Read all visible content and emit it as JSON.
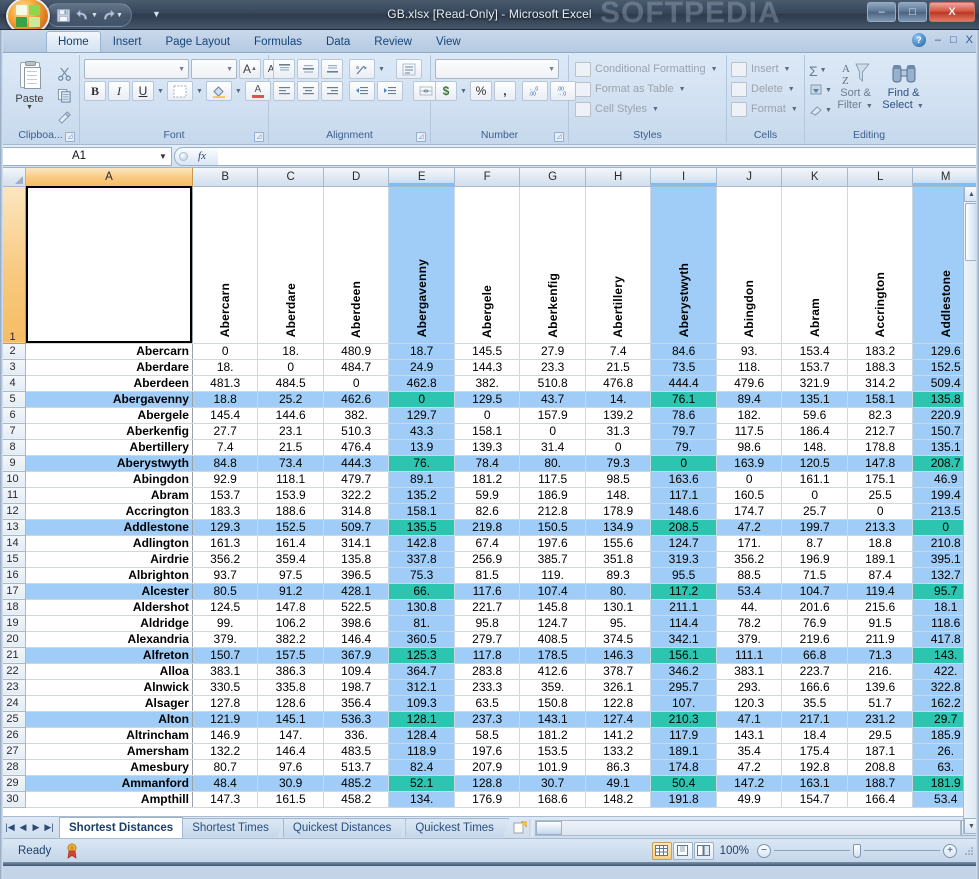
{
  "window": {
    "title": "GB.xlsx  [Read-Only] - Microsoft Excel",
    "watermark": "SOFTPEDIA",
    "minimize": "–",
    "maximize": "□",
    "close": "X"
  },
  "quick_access": {
    "save": "save-icon",
    "undo": "undo-icon",
    "redo": "redo-icon",
    "customize": "customize-icon"
  },
  "ribbon": {
    "tabs": [
      {
        "label": "Home",
        "active": true
      },
      {
        "label": "Insert",
        "active": false
      },
      {
        "label": "Page Layout",
        "active": false
      },
      {
        "label": "Formulas",
        "active": false
      },
      {
        "label": "Data",
        "active": false
      },
      {
        "label": "Review",
        "active": false
      },
      {
        "label": "View",
        "active": false
      }
    ],
    "help_label": "?",
    "minimize_ribbon": "–",
    "restore_window": "□",
    "close_window": "X",
    "groups": {
      "clipboard": {
        "label": "Clipboa...",
        "paste": "Paste",
        "cut": "cut-icon",
        "copy": "copy-icon",
        "format_painter": "format-painter-icon"
      },
      "font": {
        "label": "Font",
        "font_name": "",
        "font_size": "",
        "grow_font": "A",
        "shrink_font": "A",
        "bold": "B",
        "italic": "I",
        "underline": "U",
        "borders": "borders-icon",
        "fill_color": "fill-color-icon",
        "font_color": "A"
      },
      "alignment": {
        "label": "Alignment",
        "align_top": "align-top-icon",
        "align_middle": "align-middle-icon",
        "align_bottom": "align-bottom-icon",
        "orientation": "orientation-icon",
        "align_left": "align-left-icon",
        "align_center": "align-center-icon",
        "align_right": "align-right-icon",
        "decrease_indent": "decrease-indent-icon",
        "increase_indent": "increase-indent-icon",
        "wrap_text": "wrap-text-icon",
        "merge_center": "merge-center-icon"
      },
      "number": {
        "label": "Number",
        "format": "",
        "accounting": "$",
        "percent": "%",
        "comma": ",",
        "increase_decimal": ".00",
        "decrease_decimal": ".00"
      },
      "styles": {
        "label": "Styles",
        "items": [
          "Conditional Formatting",
          "Format as Table",
          "Cell Styles"
        ]
      },
      "cells": {
        "label": "Cells",
        "items": [
          "Insert",
          "Delete",
          "Format"
        ]
      },
      "editing": {
        "label": "Editing",
        "autosum": "Σ",
        "fill": "fill-icon",
        "clear": "clear-icon",
        "sort_filter_line1": "Sort &",
        "sort_filter_line2": "Filter",
        "find_select_line1": "Find &",
        "find_select_line2": "Select"
      }
    }
  },
  "formula_bar": {
    "name_box": "A1",
    "fx_label": "fx",
    "formula_value": ""
  },
  "grid": {
    "corner": "select-all-icon",
    "columns": [
      {
        "letter": "A",
        "selected": true,
        "highlighted": false,
        "width": 163
      },
      {
        "letter": "B",
        "selected": false,
        "highlighted": false,
        "width": 64
      },
      {
        "letter": "C",
        "selected": false,
        "highlighted": false,
        "width": 64
      },
      {
        "letter": "D",
        "selected": false,
        "highlighted": false,
        "width": 64
      },
      {
        "letter": "E",
        "selected": false,
        "highlighted": true,
        "width": 64
      },
      {
        "letter": "F",
        "selected": false,
        "highlighted": false,
        "width": 64
      },
      {
        "letter": "G",
        "selected": false,
        "highlighted": false,
        "width": 64
      },
      {
        "letter": "H",
        "selected": false,
        "highlighted": false,
        "width": 64
      },
      {
        "letter": "I",
        "selected": false,
        "highlighted": true,
        "width": 64
      },
      {
        "letter": "J",
        "selected": false,
        "highlighted": false,
        "width": 64
      },
      {
        "letter": "K",
        "selected": false,
        "highlighted": false,
        "width": 64
      },
      {
        "letter": "L",
        "selected": false,
        "highlighted": false,
        "width": 64
      },
      {
        "letter": "M",
        "selected": false,
        "highlighted": true,
        "width": 64
      }
    ],
    "header_row": {
      "number": "1",
      "a1_value": "",
      "labels": [
        "Abercarn",
        "Aberdare",
        "Aberdeen",
        "Abergavenny",
        "Abergele",
        "Aberkenfig",
        "Abertillery",
        "Aberystwyth",
        "Abingdon",
        "Abram",
        "Accrington",
        "Addlestone"
      ]
    },
    "selected_columns_idx": [
      3,
      7,
      11
    ],
    "selected_row_numbers": [
      5,
      9,
      13,
      17,
      21,
      25,
      29
    ],
    "rows": [
      {
        "n": "2",
        "name": "Abercarn",
        "values": [
          "0",
          "18.",
          "480.9",
          "18.7",
          "145.5",
          "27.9",
          "7.4",
          "84.6",
          "93.",
          "153.4",
          "183.2",
          "129.6"
        ]
      },
      {
        "n": "3",
        "name": "Aberdare",
        "values": [
          "18.",
          "0",
          "484.7",
          "24.9",
          "144.3",
          "23.3",
          "21.5",
          "73.5",
          "118.",
          "153.7",
          "188.3",
          "152.5"
        ]
      },
      {
        "n": "4",
        "name": "Aberdeen",
        "values": [
          "481.3",
          "484.5",
          "0",
          "462.8",
          "382.",
          "510.8",
          "476.8",
          "444.4",
          "479.6",
          "321.9",
          "314.2",
          "509.4"
        ]
      },
      {
        "n": "5",
        "name": "Abergavenny",
        "values": [
          "18.8",
          "25.2",
          "462.6",
          "0",
          "129.5",
          "43.7",
          "14.",
          "76.1",
          "89.4",
          "135.1",
          "158.1",
          "135.8"
        ]
      },
      {
        "n": "6",
        "name": "Abergele",
        "values": [
          "145.4",
          "144.6",
          "382.",
          "129.7",
          "0",
          "157.9",
          "139.2",
          "78.6",
          "182.",
          "59.6",
          "82.3",
          "220.9"
        ]
      },
      {
        "n": "7",
        "name": "Aberkenfig",
        "values": [
          "27.7",
          "23.1",
          "510.3",
          "43.3",
          "158.1",
          "0",
          "31.3",
          "79.7",
          "117.5",
          "186.4",
          "212.7",
          "150.7"
        ]
      },
      {
        "n": "8",
        "name": "Abertillery",
        "values": [
          "7.4",
          "21.5",
          "476.4",
          "13.9",
          "139.3",
          "31.4",
          "0",
          "79.",
          "98.6",
          "148.",
          "178.8",
          "135.1"
        ]
      },
      {
        "n": "9",
        "name": "Aberystwyth",
        "values": [
          "84.8",
          "73.4",
          "444.3",
          "76.",
          "78.4",
          "80.",
          "79.3",
          "0",
          "163.9",
          "120.5",
          "147.8",
          "208.7"
        ]
      },
      {
        "n": "10",
        "name": "Abingdon",
        "values": [
          "92.9",
          "118.1",
          "479.7",
          "89.1",
          "181.2",
          "117.5",
          "98.5",
          "163.6",
          "0",
          "161.1",
          "175.1",
          "46.9"
        ]
      },
      {
        "n": "11",
        "name": "Abram",
        "values": [
          "153.7",
          "153.9",
          "322.2",
          "135.2",
          "59.9",
          "186.9",
          "148.",
          "117.1",
          "160.5",
          "0",
          "25.5",
          "199.4"
        ]
      },
      {
        "n": "12",
        "name": "Accrington",
        "values": [
          "183.3",
          "188.6",
          "314.8",
          "158.1",
          "82.6",
          "212.8",
          "178.9",
          "148.6",
          "174.7",
          "25.7",
          "0",
          "213.5"
        ]
      },
      {
        "n": "13",
        "name": "Addlestone",
        "values": [
          "129.3",
          "152.5",
          "509.7",
          "135.5",
          "219.8",
          "150.5",
          "134.9",
          "208.5",
          "47.2",
          "199.7",
          "213.3",
          "0"
        ]
      },
      {
        "n": "14",
        "name": "Adlington",
        "values": [
          "161.3",
          "161.4",
          "314.1",
          "142.8",
          "67.4",
          "197.6",
          "155.6",
          "124.7",
          "171.",
          "8.7",
          "18.8",
          "210.8"
        ]
      },
      {
        "n": "15",
        "name": "Airdrie",
        "values": [
          "356.2",
          "359.4",
          "135.8",
          "337.8",
          "256.9",
          "385.7",
          "351.8",
          "319.3",
          "356.2",
          "196.9",
          "189.1",
          "395.1"
        ]
      },
      {
        "n": "16",
        "name": "Albrighton",
        "values": [
          "93.7",
          "97.5",
          "396.5",
          "75.3",
          "81.5",
          "119.",
          "89.3",
          "95.5",
          "88.5",
          "71.5",
          "87.4",
          "132.7"
        ]
      },
      {
        "n": "17",
        "name": "Alcester",
        "values": [
          "80.5",
          "91.2",
          "428.1",
          "66.",
          "117.6",
          "107.4",
          "80.",
          "117.2",
          "53.4",
          "104.7",
          "119.4",
          "95.7"
        ]
      },
      {
        "n": "18",
        "name": "Aldershot",
        "values": [
          "124.5",
          "147.8",
          "522.5",
          "130.8",
          "221.7",
          "145.8",
          "130.1",
          "211.1",
          "44.",
          "201.6",
          "215.6",
          "18.1"
        ]
      },
      {
        "n": "19",
        "name": "Aldridge",
        "values": [
          "99.",
          "106.2",
          "398.6",
          "81.",
          "95.8",
          "124.7",
          "95.",
          "114.4",
          "78.2",
          "76.9",
          "91.5",
          "118.6"
        ]
      },
      {
        "n": "20",
        "name": "Alexandria",
        "values": [
          "379.",
          "382.2",
          "146.4",
          "360.5",
          "279.7",
          "408.5",
          "374.5",
          "342.1",
          "379.",
          "219.6",
          "211.9",
          "417.8"
        ]
      },
      {
        "n": "21",
        "name": "Alfreton",
        "values": [
          "150.7",
          "157.5",
          "367.9",
          "125.3",
          "117.8",
          "178.5",
          "146.3",
          "156.1",
          "111.1",
          "66.8",
          "71.3",
          "143."
        ]
      },
      {
        "n": "22",
        "name": "Alloa",
        "values": [
          "383.1",
          "386.3",
          "109.4",
          "364.7",
          "283.8",
          "412.6",
          "378.7",
          "346.2",
          "383.1",
          "223.7",
          "216.",
          "422."
        ]
      },
      {
        "n": "23",
        "name": "Alnwick",
        "values": [
          "330.5",
          "335.8",
          "198.7",
          "312.1",
          "233.3",
          "359.",
          "326.1",
          "295.7",
          "293.",
          "166.6",
          "139.6",
          "322.8"
        ]
      },
      {
        "n": "24",
        "name": "Alsager",
        "values": [
          "127.8",
          "128.6",
          "356.4",
          "109.3",
          "63.5",
          "150.8",
          "122.8",
          "107.",
          "120.3",
          "35.5",
          "51.7",
          "162.2"
        ]
      },
      {
        "n": "25",
        "name": "Alton",
        "values": [
          "121.9",
          "145.1",
          "536.3",
          "128.1",
          "237.3",
          "143.1",
          "127.4",
          "210.3",
          "47.1",
          "217.1",
          "231.2",
          "29.7"
        ]
      },
      {
        "n": "26",
        "name": "Altrincham",
        "values": [
          "146.9",
          "147.",
          "336.",
          "128.4",
          "58.5",
          "181.2",
          "141.2",
          "117.9",
          "143.1",
          "18.4",
          "29.5",
          "185.9"
        ]
      },
      {
        "n": "27",
        "name": "Amersham",
        "values": [
          "132.2",
          "146.4",
          "483.5",
          "118.9",
          "197.6",
          "153.5",
          "133.2",
          "189.1",
          "35.4",
          "175.4",
          "187.1",
          "26."
        ]
      },
      {
        "n": "28",
        "name": "Amesbury",
        "values": [
          "80.7",
          "97.6",
          "513.7",
          "82.4",
          "207.9",
          "101.9",
          "86.3",
          "174.8",
          "47.2",
          "192.8",
          "208.8",
          "63."
        ]
      },
      {
        "n": "29",
        "name": "Ammanford",
        "values": [
          "48.4",
          "30.9",
          "485.2",
          "52.1",
          "128.8",
          "30.7",
          "49.1",
          "50.4",
          "147.2",
          "163.1",
          "188.7",
          "181.9"
        ]
      },
      {
        "n": "30",
        "name": "Ampthill",
        "values": [
          "147.3",
          "161.5",
          "458.2",
          "134.",
          "176.9",
          "168.6",
          "148.2",
          "191.8",
          "49.9",
          "154.7",
          "166.4",
          "53.4"
        ]
      }
    ]
  },
  "sheet_tabs": {
    "nav_first": "⏮",
    "nav_prev": "◀",
    "nav_next": "▶",
    "nav_last": "⏭",
    "tabs": [
      {
        "label": "Shortest Distances",
        "active": true
      },
      {
        "label": "Shortest Times",
        "active": false
      },
      {
        "label": "Quickest Distances",
        "active": false
      },
      {
        "label": "Quickest Times",
        "active": false
      }
    ],
    "insert_worksheet": "insert-worksheet-icon"
  },
  "status_bar": {
    "mode": "Ready",
    "signature": "signature-icon",
    "view_normal": "normal-view-icon",
    "view_page_layout": "page-layout-view-icon",
    "view_page_break": "page-break-view-icon",
    "zoom_level": "100%",
    "zoom_out": "−",
    "zoom_in": "+"
  }
}
